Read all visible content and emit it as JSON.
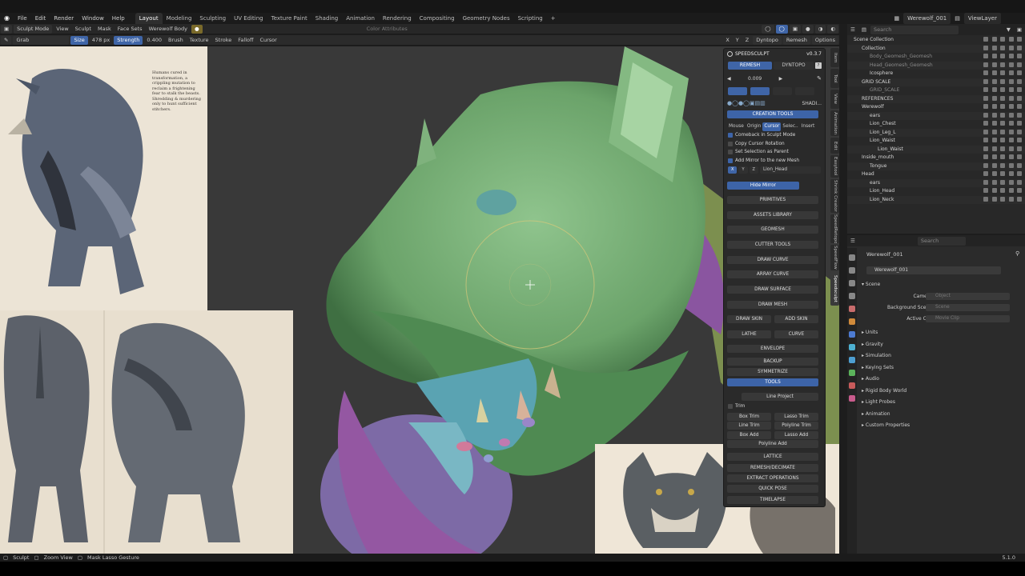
{
  "menu": {
    "items": [
      "File",
      "Edit",
      "Render",
      "Window",
      "Help"
    ]
  },
  "workspaces": [
    "Layout",
    "Modeling",
    "Sculpting",
    "UV Editing",
    "Texture Paint",
    "Shading",
    "Animation",
    "Rendering",
    "Compositing",
    "Geometry Nodes",
    "Scripting"
  ],
  "active_workspace": "Layout",
  "scene_name": "Werewolf_001",
  "view_layer": "ViewLayer",
  "header": {
    "mode": "Sculpt Mode",
    "view": "View",
    "sculpt": "Sculpt",
    "mask": "Mask",
    "face_sets": "Face Sets",
    "object": "Werewolf Body",
    "color_attributes": "Color Attributes"
  },
  "tool_header": {
    "brush_name": "Grab",
    "size_label": "Size",
    "size_value": "478 px",
    "strength_label": "Strength",
    "strength_value": "0.400",
    "brush": "Brush",
    "texture": "Texture",
    "stroke": "Stroke",
    "falloff": "Falloff",
    "cursor": "Cursor"
  },
  "viewport_header": {
    "axes": [
      "X",
      "Y",
      "Z"
    ],
    "dyntopo": "Dyntopo",
    "remesh": "Remesh",
    "options": "Options"
  },
  "speedsculpt": {
    "title": "SPEEDSCULPT",
    "version": "v0.3.7",
    "remesh": "REMESH",
    "dyntopo": "DYNTOPO",
    "value": "0.009",
    "shading": "SHADI...",
    "creation_tools": "CREATION TOOLS",
    "tabs": [
      "Mouse",
      "Origin",
      "Cursor",
      "Selec..",
      "Insert"
    ],
    "options": [
      {
        "label": "Comeback in Sculpt Mode",
        "checked": true
      },
      {
        "label": "Copy Cursor Rotation",
        "checked": false
      },
      {
        "label": "Set Selection as Parent",
        "checked": false
      },
      {
        "label": "Add Mirror to the new Mesh",
        "checked": true
      }
    ],
    "mirror_target": "Lion_Head",
    "hide_mirror": "Hide Mirror",
    "sections": [
      "PRIMITIVES",
      "ASSETS LIBRARY",
      "GEOMESH",
      "CUTTER TOOLS",
      "DRAW CURVE",
      "ARRAY CURVE",
      "DRAW SURFACE",
      "DRAW MESH"
    ],
    "draw_skin": "DRAW SKIN",
    "add_skin": "ADD SKIN",
    "lathe": "LATHE",
    "curve": "CURVE",
    "envelope": "ENVELOPE",
    "backup": "BACKUP",
    "symmetrize": "SYMMETRIZE",
    "tools": "TOOLS",
    "line_project": "Line Project",
    "trim": "Trim",
    "trim_buttons": [
      "Box Trim",
      "Lasso Trim",
      "Line Trim",
      "Polyline Trim",
      "Box Add",
      "Lasso Add"
    ],
    "polyline_add": "Polyline Add",
    "bottom_sections": [
      "LATTICE",
      "REMESH/DECIMATE",
      "EXTRACT OPERATIONS",
      "QUICK POSE",
      "TIMELAPSE"
    ]
  },
  "vertical_tabs": [
    "Item",
    "Tool",
    "View",
    "Animation",
    "Edit",
    "Easytool",
    "Shrink Creator",
    "SpeedRetopo",
    "SpeedFlow",
    "Speedsculpt"
  ],
  "outliner": {
    "search_placeholder": "Search",
    "rows": [
      {
        "label": "Scene Collection",
        "indent": 0,
        "muted": false
      },
      {
        "label": "Collection",
        "indent": 1,
        "muted": false
      },
      {
        "label": "Body_Geomesh_Geomesh",
        "indent": 2,
        "muted": true
      },
      {
        "label": "Head_Geomesh_Geomesh",
        "indent": 2,
        "muted": true
      },
      {
        "label": "Icosphere",
        "indent": 2,
        "muted": false
      },
      {
        "label": "GRID SCALE",
        "indent": 1,
        "muted": false
      },
      {
        "label": "GRID_SCALE",
        "indent": 2,
        "muted": true
      },
      {
        "label": "REFERENCES",
        "indent": 1,
        "muted": false
      },
      {
        "label": "Werewolf",
        "indent": 1,
        "muted": false
      },
      {
        "label": "ears",
        "indent": 2,
        "muted": false
      },
      {
        "label": "Lion_Chest",
        "indent": 2,
        "muted": false
      },
      {
        "label": "Lion_Leg_L",
        "indent": 2,
        "muted": false
      },
      {
        "label": "Lion_Waist",
        "indent": 2,
        "muted": false
      },
      {
        "label": "Lion_Waist",
        "indent": 3,
        "muted": false
      },
      {
        "label": "Inside_mouth",
        "indent": 1,
        "muted": false
      },
      {
        "label": "Tongue",
        "indent": 2,
        "muted": false
      },
      {
        "label": "Head",
        "indent": 1,
        "muted": false
      },
      {
        "label": "ears",
        "indent": 2,
        "muted": false
      },
      {
        "label": "Lion_Head",
        "indent": 2,
        "muted": false
      },
      {
        "label": "Lion_Neck",
        "indent": 2,
        "muted": false
      }
    ]
  },
  "properties": {
    "search_placeholder": "Search",
    "breadcrumb": "Werewolf_001",
    "scene_field": "Werewolf_001",
    "scene_section": "Scene",
    "camera_label": "Camera",
    "camera_placeholder": "Object",
    "bg_label": "Background Scene",
    "bg_placeholder": "Scene",
    "clip_label": "Active Clip",
    "clip_placeholder": "Movie Clip",
    "sections": [
      "Units",
      "Gravity",
      "Simulation",
      "Keying Sets",
      "Audio",
      "Rigid Body World",
      "Light Probes",
      "Animation",
      "Custom Properties"
    ]
  },
  "ref_text": "Humans cured in transformation, a crippling mutation to reclaim a frightening fear to stalk the beasts. Shredding & murdering only to hunt sufficient stitchers.",
  "status": {
    "sculpt": "Sculpt",
    "zoom": "Zoom View",
    "mask": "Mask Lasso Gesture",
    "version": "5.1.0"
  }
}
